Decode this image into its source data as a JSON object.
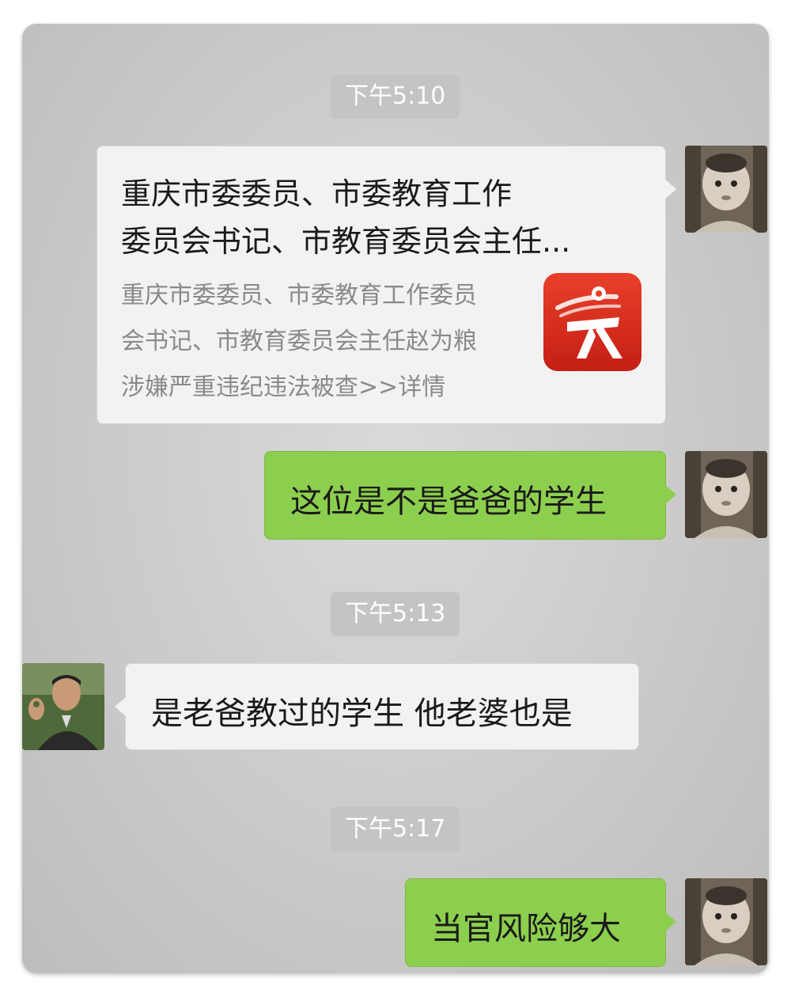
{
  "timestamps": [
    "下午5:10",
    "下午5:13",
    "下午5:17"
  ],
  "messages": {
    "m1": {
      "title_line1": "重庆市委委员、市委教育工作",
      "title_line2": "委员会书记、市教育委员会主任...",
      "desc_line1": "重庆市委委员、市委教育工作委员",
      "desc_line2": "会书记、市教育委员会主任赵为粮",
      "desc_line3": "涉嫌严重违纪违法被查>>详情",
      "icon": "news-app-icon"
    },
    "m2": {
      "text": "这位是不是爸爸的学生"
    },
    "m3": {
      "text": "是老爸教过的学生 他老婆也是"
    },
    "m4": {
      "text": "当官风险够大"
    }
  },
  "colors": {
    "sent_bubble": "#8ccf4e",
    "received_bubble": "#f2f2f2",
    "timestamp_bg": "#c4c4c4",
    "app_icon": "#d42d1f"
  }
}
